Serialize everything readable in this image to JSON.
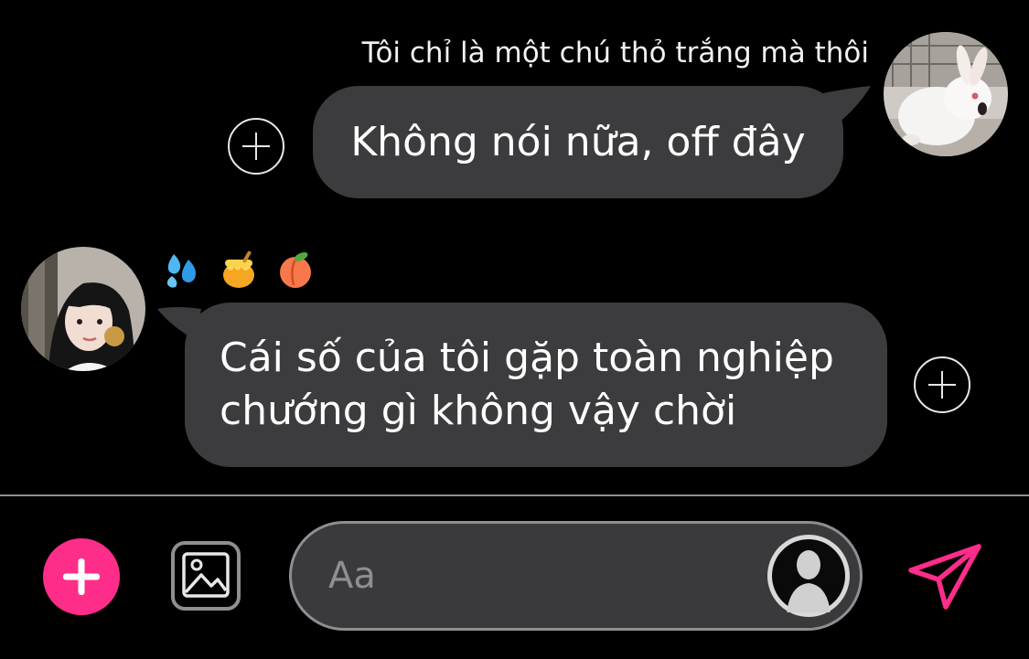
{
  "conversation": {
    "outgoing": {
      "sender_name": "Tôi chỉ là một chú thỏ trắng mà thôi",
      "text": "Không nói nữa, off đây",
      "avatar_icon": "white-rabbit-avatar"
    },
    "incoming": {
      "reactions": [
        {
          "icon": "sweat-droplets-emoji"
        },
        {
          "icon": "honey-pot-emoji"
        },
        {
          "icon": "peach-emoji"
        }
      ],
      "lines": [
        "Cái số của tôi gặp toàn nghiệp",
        "chướng gì không vậy chời"
      ],
      "avatar_icon": "girl-avatar"
    },
    "add_reaction_icon": "circle-plus-icon"
  },
  "composer": {
    "placeholder": "Aa",
    "plus_icon": "plus-icon",
    "gallery_icon": "image-gallery-icon",
    "profile_icon": "profile-silhouette-icon",
    "send_icon": "paper-plane-icon"
  },
  "colors": {
    "background": "#000000",
    "bubble": "#3c3c3e",
    "accent": "#ff2d8a",
    "text": "#ffffff",
    "muted": "#8e8e93"
  }
}
